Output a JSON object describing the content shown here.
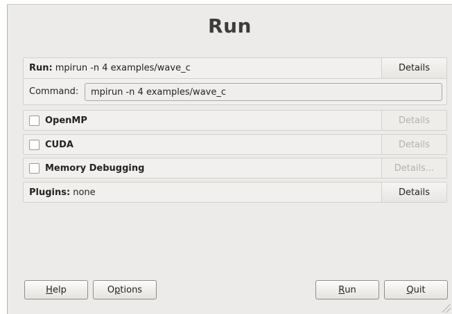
{
  "window": {
    "title": "Run"
  },
  "run_panel": {
    "label_bold": "Run:",
    "label_value": "mpirun -n 4 examples/wave_c",
    "details": "Details",
    "command_label": "Command:",
    "command_value": "mpirun -n 4 examples/wave_c"
  },
  "options": [
    {
      "label": "OpenMP",
      "checked": false,
      "details": "Details",
      "details_enabled": false
    },
    {
      "label": "CUDA",
      "checked": false,
      "details": "Details",
      "details_enabled": false
    },
    {
      "label": "Memory Debugging",
      "checked": false,
      "details": "Details...",
      "details_enabled": false
    }
  ],
  "plugins": {
    "label_bold": "Plugins:",
    "label_value": "none",
    "details": "Details"
  },
  "footer": {
    "help_mnemonic": "H",
    "help_rest": "elp",
    "options_pre": "O",
    "options_mnemonic": "p",
    "options_rest": "tions",
    "run_mnemonic": "R",
    "run_rest": "un",
    "quit_mnemonic": "Q",
    "quit_rest": "uit"
  }
}
